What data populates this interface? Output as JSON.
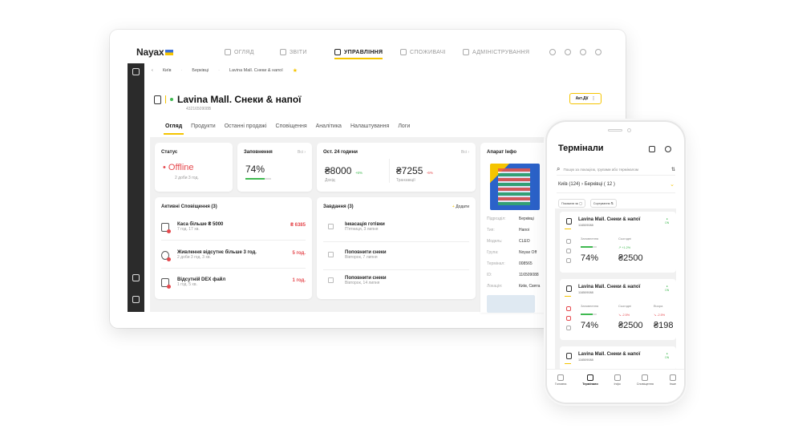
{
  "brand": "Nayax",
  "nav": [
    {
      "label": "ОГЛЯД",
      "active": false
    },
    {
      "label": "ЗВІТИ",
      "active": false
    },
    {
      "label": "УПРАВЛІННЯ",
      "active": true
    },
    {
      "label": "СПОЖИВАЧІ",
      "active": false
    },
    {
      "label": "АДМІНІСТРУВАННЯ",
      "active": false
    }
  ],
  "breadcrumb": [
    "Київ",
    "Берківці",
    "Lavina Mall. Снеки & напої"
  ],
  "header": {
    "title": "Lavina Mall. Снеки & напої",
    "id": "4321650908В",
    "action_label": "Акт.Дії"
  },
  "tabs": [
    "Огляд",
    "Продукти",
    "Останні продажі",
    "Сповіщення",
    "Аналітика",
    "Налаштування",
    "Логи"
  ],
  "status": {
    "title": "Статус",
    "value": "Offline",
    "sub": "2 доби 3 год."
  },
  "fill": {
    "title": "Заповнення",
    "filter": "Всі",
    "value": "74%",
    "level": 0.74
  },
  "last24": {
    "title": "Ост. 24 години",
    "filter": "Всі",
    "income": "₴8000",
    "income_delta": "+6%",
    "income_label": "Дохід",
    "tx": "₴7255",
    "tx_delta": "-6%",
    "tx_label": "Транзакції"
  },
  "device": {
    "title": "Апарат Інфо",
    "rows": [
      {
        "k": "Підрозділ:",
        "v": "Берківці"
      },
      {
        "k": "Тип:",
        "v": "Hanoi"
      },
      {
        "k": "Модель:",
        "v": "CLEO"
      },
      {
        "k": "Група:",
        "v": "Noyax Off"
      },
      {
        "k": "Термінал:",
        "v": "008565"
      },
      {
        "k": "ID:",
        "v": "116509088"
      },
      {
        "k": "Локація:",
        "v": "Київ, Свята"
      }
    ]
  },
  "alerts": {
    "title": "Активні Сповіщення (3)",
    "items": [
      {
        "title": "Каса більше ₴ 5000",
        "sub": "7 год. 17 хв.",
        "value": "₴ 6385"
      },
      {
        "title": "Живлення відсутнє більше 3 год.",
        "sub": "2 доби 3 год. 3 хв.",
        "value": "5 год."
      },
      {
        "title": "Відсутній DEX файл",
        "sub": "1 год. 5 хв.",
        "value": "1 год."
      }
    ]
  },
  "tasks": {
    "title": "Завдання (3)",
    "add_label": "Додати",
    "items": [
      {
        "title": "Інкасація готівки",
        "sub": "П'ятниця, 3 липня"
      },
      {
        "title": "Поповнити снеки",
        "sub": "Вівторок, 7 липня"
      },
      {
        "title": "Поповнити снеки",
        "sub": "Вівторок, 14 липня"
      }
    ]
  },
  "phone": {
    "title": "Термінали",
    "search_placeholder": "Пошук за локацією, групами або терміналом",
    "location": "Київ  (124)  ›  Берківці  ( 12 )",
    "chip_1": "Показати як",
    "chip_2": "Сортування",
    "cards": [
      {
        "title": "Lavina Mall. Снеки & напої",
        "id": "116509088",
        "status": "ON",
        "fill_label": "Заповнення",
        "fill": "74%",
        "fill_level": 0.74,
        "today_label": "Сьогодні",
        "today": "₴2500",
        "delta": "+1.2%"
      },
      {
        "title": "Lavina Mall. Снеки & напої",
        "id": "116509088",
        "status": "ON",
        "fill_label": "Заповнення",
        "fill": "74%",
        "fill_level": 0.74,
        "today_label": "Сьогодні",
        "today": "₴2500",
        "delta": "-2.5%",
        "yest_label": "Вчора",
        "yest": "₴198",
        "yest_delta": "-2.5%"
      },
      {
        "title": "Lavina Mall. Снеки & напої",
        "id": "116509088",
        "status": "ON"
      }
    ],
    "tabbar": [
      {
        "label": "Головна",
        "active": false
      },
      {
        "label": "Термінали",
        "active": true
      },
      {
        "label": "Інфо",
        "active": false
      },
      {
        "label": "Сповіщення",
        "active": false
      },
      {
        "label": "Інше",
        "active": false
      }
    ]
  }
}
